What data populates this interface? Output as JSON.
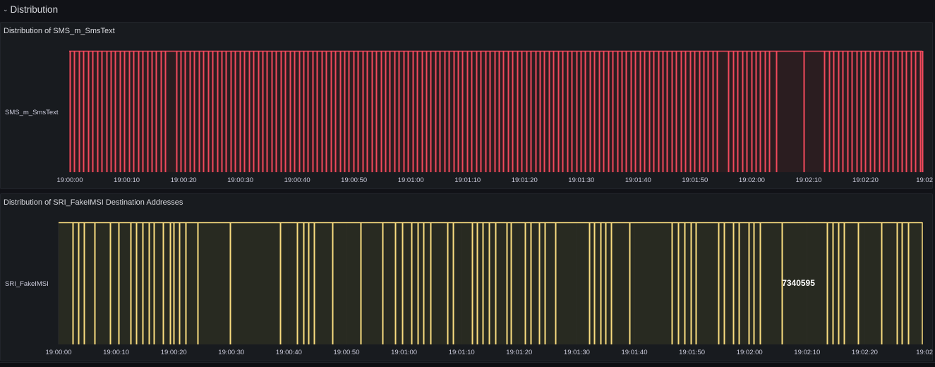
{
  "row": {
    "title": "Distribution",
    "chevron_icon": "chevron-down-icon"
  },
  "panels": [
    {
      "title": "Distribution of SMS_m_SmsText",
      "color": "#f2495c",
      "band_fill": "#2f1d21",
      "chart_data": {
        "type": "state-timeline",
        "rows": [
          "SMS_m_SmsText"
        ],
        "x_ticks": [
          "19:00:00",
          "19:00:10",
          "19:00:20",
          "19:00:30",
          "19:00:40",
          "19:00:50",
          "19:01:00",
          "19:01:10",
          "19:01:20",
          "19:01:30",
          "19:01:40",
          "19:01:50",
          "19:02:00",
          "19:02:10",
          "19:02:20",
          "19:02"
        ],
        "x_range_seconds": [
          0,
          150
        ],
        "events_seconds": [
          0,
          0.8,
          1.6,
          2.4,
          3.2,
          4,
          4.8,
          5.6,
          6.4,
          7.2,
          8,
          8.8,
          9.6,
          10.4,
          11.2,
          12,
          12.8,
          13.6,
          14.4,
          15.2,
          16,
          16.8,
          18.7,
          19.5,
          20.3,
          21.1,
          21.9,
          22.7,
          23.5,
          24.3,
          25.1,
          25.9,
          26.7,
          27.5,
          28.3,
          29.1,
          29.9,
          30.7,
          31.5,
          32.3,
          33.1,
          33.9,
          34.7,
          35.5,
          36.3,
          37.1,
          37.9,
          38.7,
          39.5,
          40.3,
          41.1,
          41.9,
          42.7,
          43.5,
          44.3,
          45.1,
          45.9,
          46.7,
          47.5,
          48.3,
          49.1,
          49.9,
          50.7,
          51.5,
          52.3,
          53.1,
          53.9,
          54.7,
          55.5,
          56.3,
          57.1,
          57.9,
          58.7,
          59.5,
          60.3,
          61.1,
          61.9,
          62.7,
          63.5,
          64.3,
          65.1,
          65.9,
          66.7,
          67.5,
          68.3,
          69.1,
          69.9,
          70.7,
          71.5,
          72.3,
          73.1,
          73.9,
          74.7,
          75.5,
          76.3,
          77.1,
          77.9,
          78.7,
          79.5,
          80.3,
          81.1,
          81.9,
          82.7,
          83.5,
          84.3,
          85.1,
          85.9,
          86.7,
          87.5,
          88.3,
          89.1,
          89.9,
          90.7,
          91.5,
          92.3,
          93.1,
          93.9,
          94.7,
          95.5,
          96.3,
          97.1,
          97.9,
          98.7,
          99.5,
          100.3,
          101.1,
          101.9,
          102.7,
          103.5,
          104.3,
          105.1,
          105.9,
          106.7,
          107.5,
          108.3,
          109.1,
          109.9,
          110.7,
          111.5,
          112.3,
          113.1,
          113.9,
          115.9,
          116.7,
          117.5,
          118.3,
          119.1,
          119.9,
          120.7,
          121.5,
          122.3,
          123.1,
          124.3,
          129.1,
          132.8,
          133.6,
          134.4,
          135.2,
          136,
          136.8,
          137.6,
          138.4,
          139.2,
          140,
          140.8,
          141.6,
          142.4,
          143.2,
          144,
          144.8,
          145.6,
          146.4,
          147.2,
          148,
          148.8,
          149.6,
          150
        ],
        "value_labels": []
      }
    },
    {
      "title": "Distribution of SRI_FakeIMSI Destination Addresses",
      "color": "#fadd80",
      "band_fill": "#2b2d22",
      "chart_data": {
        "type": "state-timeline",
        "rows": [
          "SRI_FakeIMSI"
        ],
        "x_ticks": [
          "19:00:00",
          "19:00:10",
          "19:00:20",
          "19:00:30",
          "19:00:40",
          "19:00:50",
          "19:01:00",
          "19:01:10",
          "19:01:20",
          "19:01:30",
          "19:01:40",
          "19:01:50",
          "19:02:00",
          "19:02:10",
          "19:02:20",
          "19:02"
        ],
        "x_range_seconds": [
          0,
          150
        ],
        "events_seconds": [
          2.5,
          3.4,
          4.4,
          6.3,
          9,
          10.4,
          12.5,
          13.5,
          14.6,
          15.7,
          16.6,
          18.1,
          19.4,
          20,
          21,
          22,
          24.2,
          29.8,
          38.5,
          41.4,
          42.5,
          43.4,
          44.4,
          47.6,
          52.5,
          56.2,
          58.5,
          59.7,
          61.3,
          62.4,
          63.4,
          64.6,
          67.5,
          68.5,
          71.8,
          72.7,
          73.6,
          74.8,
          75.8,
          77.8,
          78.5,
          81,
          82,
          83.5,
          84.4,
          86.3,
          92.1,
          93,
          94.1,
          95,
          96,
          99.2,
          106.5,
          107.6,
          108.7,
          109.8,
          110.7,
          114.6,
          115.6,
          117.2,
          118.1,
          119.9,
          120.7,
          121.8,
          125.6,
          133.5,
          134.4,
          135.4,
          136.4,
          138.8,
          142.9,
          145.6,
          146.5,
          147.5
        ],
        "value_labels": [
          {
            "x_seconds": 128.5,
            "text": "7340595"
          }
        ]
      }
    }
  ]
}
